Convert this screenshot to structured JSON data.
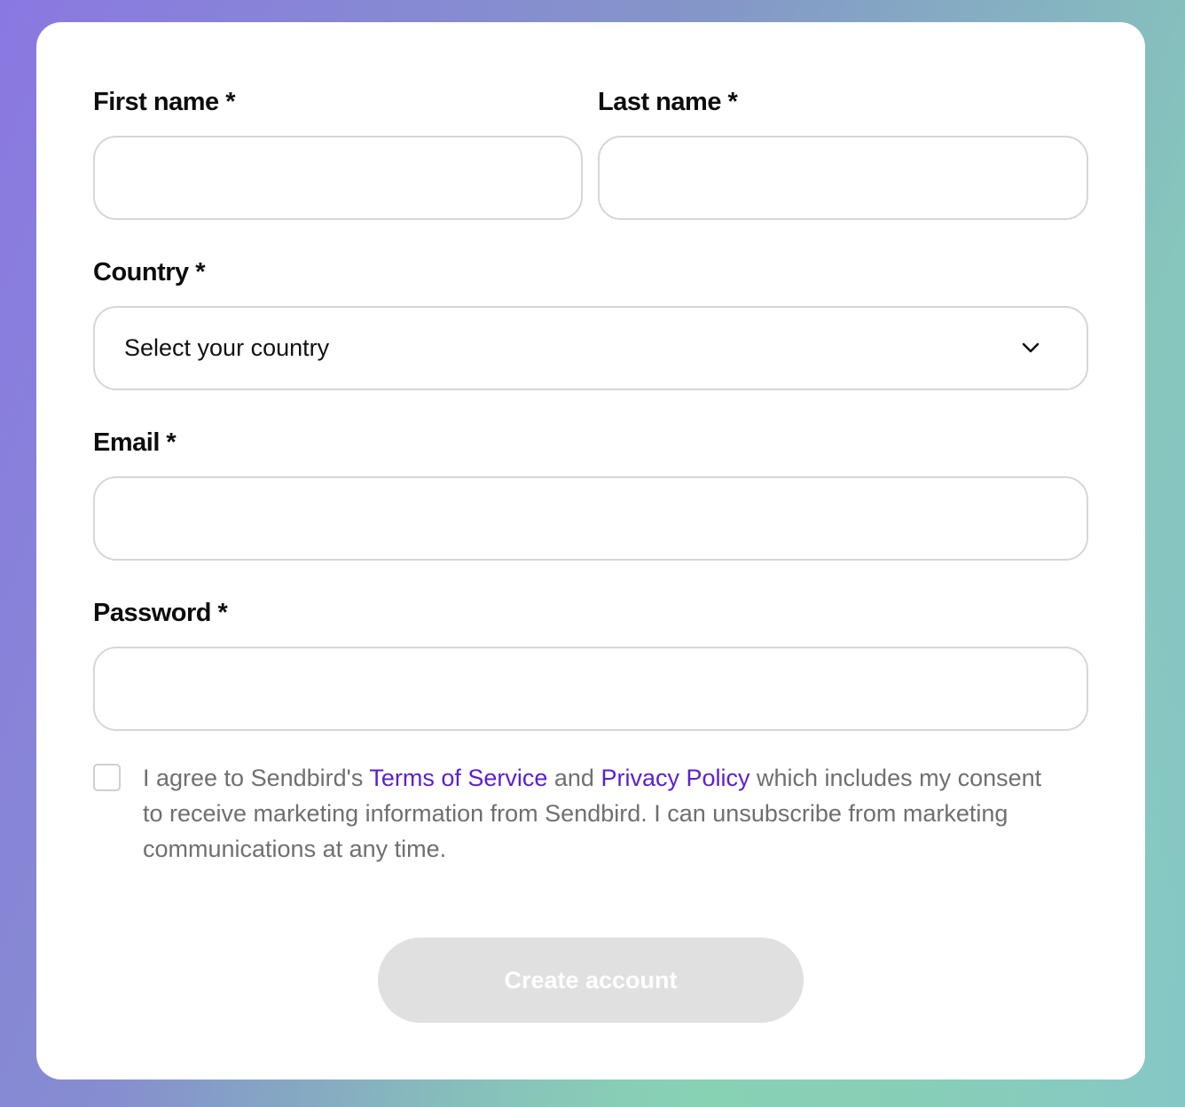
{
  "form": {
    "first_name_label": "First name *",
    "last_name_label": "Last name *",
    "country_label": "Country *",
    "country_value": "Select your country",
    "email_label": "Email *",
    "password_label": "Password *",
    "consent": {
      "text_1": "I agree to Sendbird's ",
      "terms_link": "Terms of Service",
      "text_2": " and ",
      "privacy_link": "Privacy Policy",
      "text_3": " which includes my consent to receive marketing information from Sendbird. I can unsubscribe from marketing communications at any time."
    },
    "submit_label": "Create account"
  },
  "colors": {
    "link": "#5a1fd1",
    "button_disabled": "#e0e0e0"
  }
}
